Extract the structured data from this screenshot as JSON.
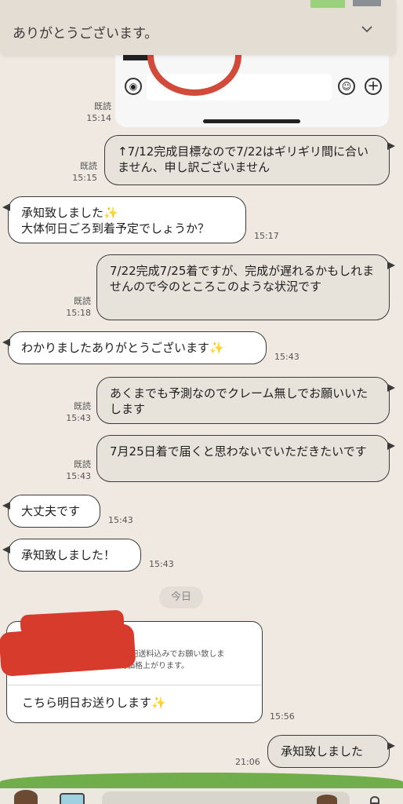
{
  "pinned_message": "ありがとうございます。",
  "messages": [
    {
      "read": "既読",
      "time": "15:14"
    },
    {
      "read": "既読",
      "time": "15:15",
      "text": "↑7/12完成目標なので7/22はギリギリ間に合いません、申し訳ございません"
    },
    {
      "time": "15:17",
      "line1": "承知致しました✨",
      "line2": "大体何日ごろ到着予定でしょうか？"
    },
    {
      "read": "既読",
      "time": "15:18",
      "text": "7/22完成7/25着ですが、完成が遅れるかもしれませんので今のところこのような状況です"
    },
    {
      "time": "15:43",
      "text": "わかりましたありがとうございます✨"
    },
    {
      "read": "既読",
      "time": "15:43",
      "text": "あくまでも予測なのでクレーム無しでお願いいたします"
    },
    {
      "read": "既読",
      "time": "15:43",
      "text": "7月25日着で届くと思わないでいただきたいです"
    },
    {
      "time": "15:43",
      "text": "大丈夫です"
    },
    {
      "time": "15:43",
      "text": "承知致しました！"
    }
  ],
  "date_separator": "今日",
  "card": {
    "quote_line1": "3万円送料込みでお願い致しま",
    "quote_line2": "す（輸出料金の為価格上がります。",
    "reply": "こちら明日お送りします✨",
    "time": "15:56"
  },
  "last": {
    "time": "21:06",
    "text": "承知致しました"
  }
}
